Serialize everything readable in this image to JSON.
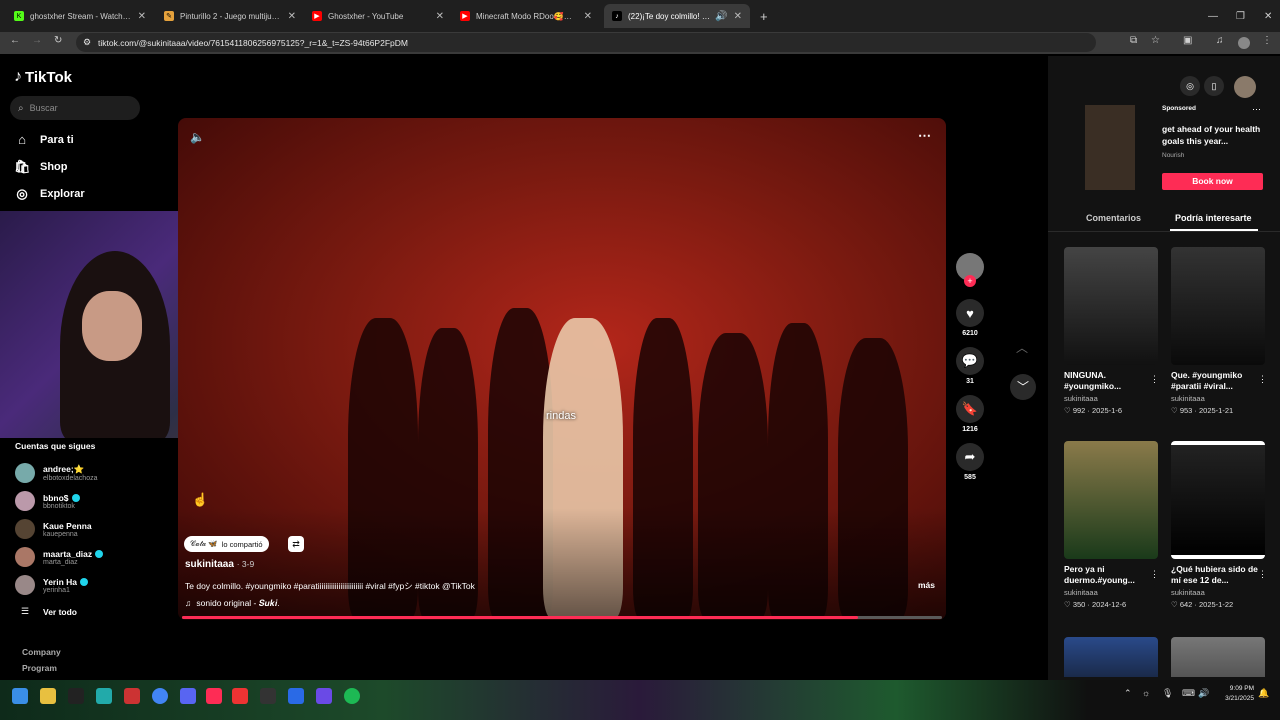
{
  "browser": {
    "tabs": [
      {
        "title": "ghostxher Stream - Watch Live",
        "icon_color": "#53fc18",
        "icon": "K"
      },
      {
        "title": "Pinturillo 2 - Juego multijugador",
        "icon_color": "#e6a23c",
        "icon": "✎"
      },
      {
        "title": "Ghostxher - YouTube",
        "icon_color": "#ff0000",
        "icon": "▶"
      },
      {
        "title": "Minecraft Modo RDoo🥰🥰 #",
        "icon_color": "#ff0000",
        "icon": "▶"
      },
      {
        "title": "(22)¡Te doy colmillo! Descub",
        "icon_color": "#000000",
        "icon": "♪",
        "active": true
      }
    ],
    "new_tab": "+",
    "url": "tiktok.com/@sukinitaaa/video/7615411806256975125?_r=1&_t=ZS-94t66P2FpDM"
  },
  "sidebar": {
    "logo": "TikTok",
    "search_placeholder": "Buscar",
    "nav": [
      {
        "label": "Para ti",
        "icon": "⌂"
      },
      {
        "label": "Shop",
        "icon": "🛍"
      },
      {
        "label": "Explorar",
        "icon": "◎"
      }
    ],
    "following_title": "Cuentas que sigues",
    "accounts": [
      {
        "name": "andree;⭐",
        "handle": "elbotoxdelachoza",
        "verified": false
      },
      {
        "name": "bbno$",
        "handle": "bbnotiktok",
        "verified": true
      },
      {
        "name": "Kaue Penna",
        "handle": "kauepenna",
        "verified": false
      },
      {
        "name": "maarta_diaz",
        "handle": "marta_diaz",
        "verified": true
      },
      {
        "name": "Yerin Ha",
        "handle": "yerinha1",
        "verified": true
      }
    ],
    "see_all": "Ver todo",
    "footer": [
      "Company",
      "Program"
    ]
  },
  "video": {
    "subtitle_text": "rindas",
    "shared_by": "𝒞𝒶𝓉𝒶 🦋",
    "shared_label": "lo compartió",
    "author": "sukinitaaa",
    "date": "· 3-9",
    "caption": "Te doy colmillo. #youngmiko #paratiiiiiiiiiiiiiiiiiiiiiiii #viral #fypシ #tiktok @TikTok",
    "more": "más",
    "sound": "sonido original - 𝑺𝒖𝒌𝒊.",
    "progress": 0.89
  },
  "actions": {
    "likes": "6210",
    "comments": "31",
    "saves": "1216",
    "shares": "585"
  },
  "right_panel": {
    "ad": {
      "label": "Sponsored",
      "text": "get ahead of your health goals this year...",
      "brand": "Nourish",
      "cta": "Book now"
    },
    "tabs": [
      "Comentarios",
      "Podría interesarte"
    ],
    "cards": [
      {
        "caption": "NINGUNA. #youngmiko...",
        "user": "sukinitaaa",
        "likes": "992",
        "date": "2025-1-6",
        "thumb_color": "#2e2e2e"
      },
      {
        "caption": "Que. #youngmiko #paratii #viral...",
        "user": "sukinitaaa",
        "likes": "953",
        "date": "2025-1-21",
        "thumb_color": "#1e1e22"
      },
      {
        "caption": "Pero ya ni duermo.#young...",
        "user": "sukinitaaa",
        "likes": "350",
        "date": "2024-12-6",
        "thumb_color": "#4a4a2a"
      },
      {
        "caption": "¿Qué hubiera sido de mí ese 12 de...",
        "user": "sukinitaaa",
        "likes": "642",
        "date": "2025-1-22",
        "thumb_color": "#101010"
      }
    ]
  },
  "taskbar": {
    "time": "9:09 PM",
    "date": "3/21/2025"
  }
}
